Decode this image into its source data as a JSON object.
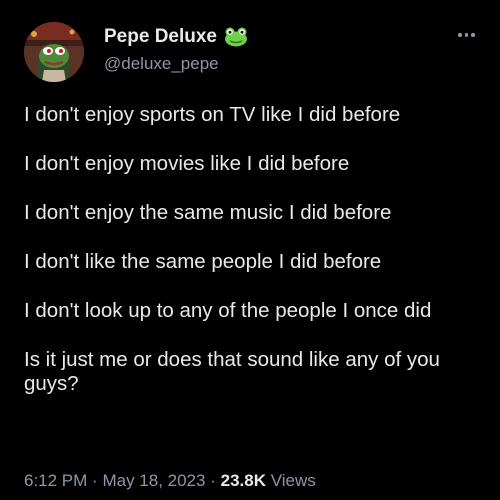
{
  "author": {
    "display_name": "Pepe Deluxe",
    "handle": "@deluxe_pepe",
    "verified_badge_icon": "frog-emoji-icon",
    "avatar_icon": "pepe-avatar-icon"
  },
  "menu": {
    "icon": "more-dots-icon"
  },
  "tweet": {
    "paragraphs": [
      "I don't enjoy sports on TV like I did before",
      "I don't enjoy movies like I did before",
      "I don't enjoy the same music I did before",
      "I don't like the same people I did before",
      "I don't look up to any of the people I once did",
      "Is it just me or does that sound like any of you guys?"
    ]
  },
  "meta": {
    "time": "6:12 PM",
    "separator": "·",
    "date": "May 18, 2023",
    "views_count": "23.8K",
    "views_label": "Views"
  },
  "colors": {
    "background": "#000000",
    "text": "#e7e9ea",
    "secondary": "#8b98a5"
  }
}
